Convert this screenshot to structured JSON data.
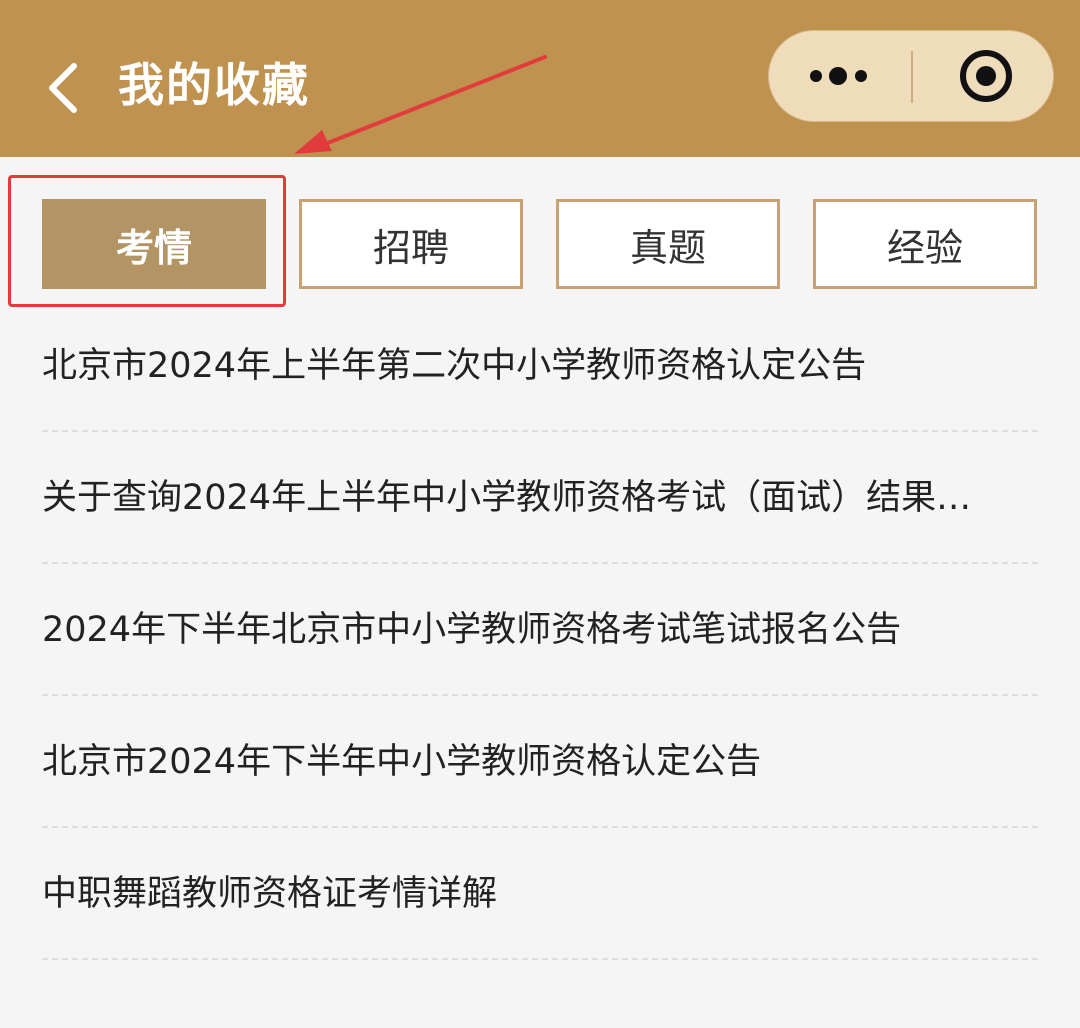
{
  "header": {
    "title": "我的收藏",
    "background": "#bf924f",
    "back_icon": "chevron-left-icon",
    "capsule": {
      "more_icon": "more-dots-icon",
      "close_icon": "target-circle-icon"
    }
  },
  "annotation": {
    "arrow_color": "#e23b3b",
    "highlight_color": "#e23b3b"
  },
  "tabs": [
    {
      "label": "考情",
      "active": true
    },
    {
      "label": "招聘",
      "active": false
    },
    {
      "label": "真题",
      "active": false
    },
    {
      "label": "经验",
      "active": false
    }
  ],
  "colors": {
    "tab_active_bg": "#b39565",
    "tab_border": "#c8a274",
    "page_bg": "#f5f5f5"
  },
  "list": {
    "items": [
      {
        "title": "北京市2024年上半年第二次中小学教师资格认定公告"
      },
      {
        "title": "关于查询2024年上半年中小学教师资格考试（面试）结果…"
      },
      {
        "title": "2024年下半年北京市中小学教师资格考试笔试报名公告"
      },
      {
        "title": "北京市2024年下半年中小学教师资格认定公告"
      },
      {
        "title": "中职舞蹈教师资格证考情详解"
      }
    ]
  }
}
